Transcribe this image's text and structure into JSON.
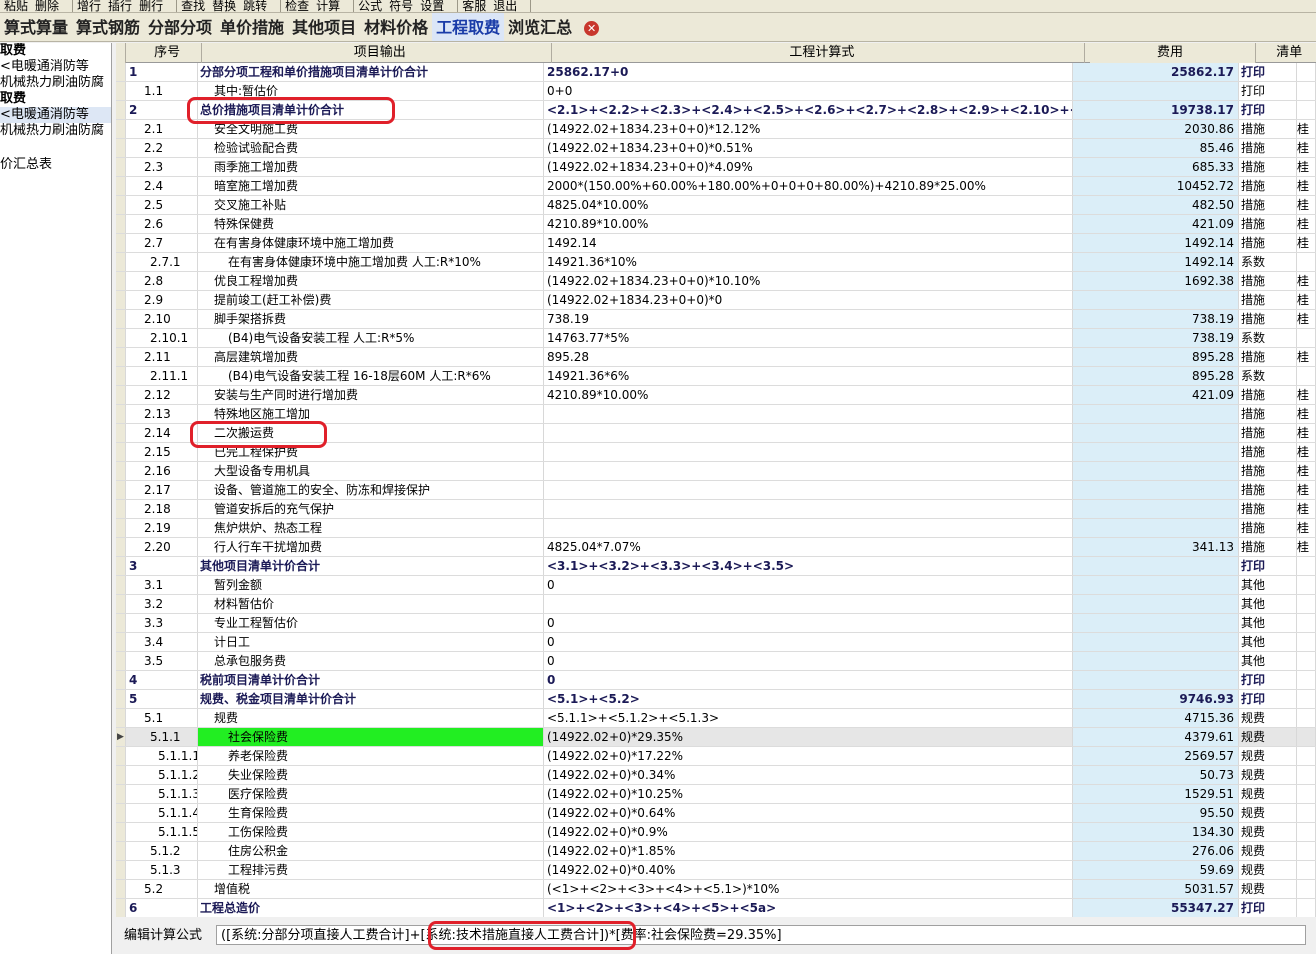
{
  "menu": {
    "groups": [
      {
        "items": [
          "粘贴",
          "删除"
        ]
      },
      {
        "items": [
          "增行",
          "插行",
          "删行"
        ]
      },
      {
        "items": [
          "查找",
          "替换",
          "跳转"
        ]
      },
      {
        "items": [
          "检查",
          "计算"
        ]
      },
      {
        "items": [
          "公式",
          "符号",
          "设置"
        ]
      },
      {
        "items": [
          "客服",
          "退出"
        ]
      }
    ]
  },
  "tabs": [
    "算式算量",
    "算式钢筋",
    "分部分项",
    "单价措施",
    "其他项目",
    "材料价格",
    "工程取费",
    "浏览汇总"
  ],
  "active_tab": "工程取费",
  "tree": [
    "取费",
    "<电暖通消防等",
    "机械热力刷油防腐",
    "取费",
    "<电暖通消防等",
    "机械热力刷油防腐",
    "价汇总表"
  ],
  "columns": [
    "序号",
    "项目输出",
    "工程计算式",
    "费用",
    "清单"
  ],
  "rows": [
    {
      "seq": "1",
      "name": "分部分项工程和单价措施项目清单计价合计",
      "formula": "25862.17+0",
      "fee": "25862.17",
      "type": "打印",
      "extra": "",
      "bold": true
    },
    {
      "seq": "1.1",
      "name": "其中:暂估价",
      "formula": "0+0",
      "fee": "",
      "type": "打印",
      "extra": ""
    },
    {
      "seq": "2",
      "name": "总价措施项目清单计价合计",
      "formula": "<2.1>+<2.2>+<2.3>+<2.4>+<2.5>+<2.6>+<2.7>+<2.8>+<2.9>+<2.10>+<2.11",
      "fee": "19738.17",
      "type": "打印",
      "extra": "",
      "bold": true
    },
    {
      "seq": "2.1",
      "name": "安全文明施工费",
      "formula": "(14922.02+1834.23+0+0)*12.12%",
      "fee": "2030.86",
      "type": "措施",
      "extra": "桂"
    },
    {
      "seq": "2.2",
      "name": "检验试验配合费",
      "formula": "(14922.02+1834.23+0+0)*0.51%",
      "fee": "85.46",
      "type": "措施",
      "extra": "桂"
    },
    {
      "seq": "2.3",
      "name": "雨季施工增加费",
      "formula": "(14922.02+1834.23+0+0)*4.09%",
      "fee": "685.33",
      "type": "措施",
      "extra": "桂"
    },
    {
      "seq": "2.4",
      "name": "暗室施工增加费",
      "formula": "2000*(150.00%+60.00%+180.00%+0+0+0+80.00%)+4210.89*25.00%",
      "fee": "10452.72",
      "type": "措施",
      "extra": "桂"
    },
    {
      "seq": "2.5",
      "name": "交叉施工补贴",
      "formula": "4825.04*10.00%",
      "fee": "482.50",
      "type": "措施",
      "extra": "桂"
    },
    {
      "seq": "2.6",
      "name": "特殊保健费",
      "formula": "4210.89*10.00%",
      "fee": "421.09",
      "type": "措施",
      "extra": "桂"
    },
    {
      "seq": "2.7",
      "name": "在有害身体健康环境中施工增加费",
      "formula": "1492.14",
      "fee": "1492.14",
      "type": "措施",
      "extra": "桂"
    },
    {
      "seq": "2.7.1",
      "name": "在有害身体健康环境中施工增加费 人工:R*10%",
      "formula": "14921.36*10%",
      "fee": "1492.14",
      "type": "系数",
      "extra": "",
      "indent": 2
    },
    {
      "seq": "2.8",
      "name": "优良工程增加费",
      "formula": "(14922.02+1834.23+0+0)*10.10%",
      "fee": "1692.38",
      "type": "措施",
      "extra": "桂"
    },
    {
      "seq": "2.9",
      "name": "提前竣工(赶工补偿)费",
      "formula": "(14922.02+1834.23+0+0)*0",
      "fee": "",
      "type": "措施",
      "extra": "桂"
    },
    {
      "seq": "2.10",
      "name": "脚手架搭拆费",
      "formula": "738.19",
      "fee": "738.19",
      "type": "措施",
      "extra": "桂"
    },
    {
      "seq": "2.10.1",
      "name": "(B4)电气设备安装工程 人工:R*5%",
      "formula": "14763.77*5%",
      "fee": "738.19",
      "type": "系数",
      "extra": "",
      "indent": 2
    },
    {
      "seq": "2.11",
      "name": "高层建筑增加费",
      "formula": "895.28",
      "fee": "895.28",
      "type": "措施",
      "extra": "桂"
    },
    {
      "seq": "2.11.1",
      "name": "(B4)电气设备安装工程 16-18层60M 人工:R*6%",
      "formula": "14921.36*6%",
      "fee": "895.28",
      "type": "系数",
      "extra": "",
      "indent": 2
    },
    {
      "seq": "2.12",
      "name": "安装与生产同时进行增加费",
      "formula": "4210.89*10.00%",
      "fee": "421.09",
      "type": "措施",
      "extra": "桂"
    },
    {
      "seq": "2.13",
      "name": "特殊地区施工增加",
      "formula": "",
      "fee": "",
      "type": "措施",
      "extra": "桂"
    },
    {
      "seq": "2.14",
      "name": "二次搬运费",
      "formula": "",
      "fee": "",
      "type": "措施",
      "extra": "桂"
    },
    {
      "seq": "2.15",
      "name": "已完工程保护费",
      "formula": "",
      "fee": "",
      "type": "措施",
      "extra": "桂"
    },
    {
      "seq": "2.16",
      "name": "大型设备专用机具",
      "formula": "",
      "fee": "",
      "type": "措施",
      "extra": "桂"
    },
    {
      "seq": "2.17",
      "name": "设备、管道施工的安全、防冻和焊接保护",
      "formula": "",
      "fee": "",
      "type": "措施",
      "extra": "桂"
    },
    {
      "seq": "2.18",
      "name": "管道安拆后的充气保护",
      "formula": "",
      "fee": "",
      "type": "措施",
      "extra": "桂"
    },
    {
      "seq": "2.19",
      "name": "焦炉烘炉、热态工程",
      "formula": "",
      "fee": "",
      "type": "措施",
      "extra": "桂"
    },
    {
      "seq": "2.20",
      "name": "行人行车干扰增加费",
      "formula": "4825.04*7.07%",
      "fee": "341.13",
      "type": "措施",
      "extra": "桂"
    },
    {
      "seq": "3",
      "name": "其他项目清单计价合计",
      "formula": "<3.1>+<3.2>+<3.3>+<3.4>+<3.5>",
      "fee": "",
      "type": "打印",
      "extra": "",
      "bold": true
    },
    {
      "seq": "3.1",
      "name": "暂列金额",
      "formula": "0",
      "fee": "",
      "type": "其他",
      "extra": ""
    },
    {
      "seq": "3.2",
      "name": "材料暂估价",
      "formula": "",
      "fee": "",
      "type": "其他",
      "extra": ""
    },
    {
      "seq": "3.3",
      "name": "专业工程暂估价",
      "formula": "0",
      "fee": "",
      "type": "其他",
      "extra": ""
    },
    {
      "seq": "3.4",
      "name": "计日工",
      "formula": "0",
      "fee": "",
      "type": "其他",
      "extra": ""
    },
    {
      "seq": "3.5",
      "name": "总承包服务费",
      "formula": "0",
      "fee": "",
      "type": "其他",
      "extra": ""
    },
    {
      "seq": "4",
      "name": "税前项目清单计价合计",
      "formula": "0",
      "fee": "",
      "type": "打印",
      "extra": "",
      "bold": true
    },
    {
      "seq": "5",
      "name": "规费、税金项目清单计价合计",
      "formula": "<5.1>+<5.2>",
      "fee": "9746.93",
      "type": "打印",
      "extra": "",
      "bold": true
    },
    {
      "seq": "5.1",
      "name": "规费",
      "formula": "<5.1.1>+<5.1.2>+<5.1.3>",
      "fee": "4715.36",
      "type": "规费",
      "extra": ""
    },
    {
      "seq": "5.1.1",
      "name": "社会保险费",
      "formula": "(14922.02+0)*29.35%",
      "fee": "4379.61",
      "type": "规费",
      "extra": "",
      "indent": 2,
      "current": true
    },
    {
      "seq": "5.1.1.1",
      "name": "养老保险费",
      "formula": "(14922.02+0)*17.22%",
      "fee": "2569.57",
      "type": "规费",
      "extra": "",
      "indent": 2
    },
    {
      "seq": "5.1.1.2",
      "name": "失业保险费",
      "formula": "(14922.02+0)*0.34%",
      "fee": "50.73",
      "type": "规费",
      "extra": "",
      "indent": 2
    },
    {
      "seq": "5.1.1.3",
      "name": "医疗保险费",
      "formula": "(14922.02+0)*10.25%",
      "fee": "1529.51",
      "type": "规费",
      "extra": "",
      "indent": 2
    },
    {
      "seq": "5.1.1.4",
      "name": "生育保险费",
      "formula": "(14922.02+0)*0.64%",
      "fee": "95.50",
      "type": "规费",
      "extra": "",
      "indent": 2
    },
    {
      "seq": "5.1.1.5",
      "name": "工伤保险费",
      "formula": "(14922.02+0)*0.9%",
      "fee": "134.30",
      "type": "规费",
      "extra": "",
      "indent": 2
    },
    {
      "seq": "5.1.2",
      "name": "住房公积金",
      "formula": "(14922.02+0)*1.85%",
      "fee": "276.06",
      "type": "规费",
      "extra": "",
      "indent": 2
    },
    {
      "seq": "5.1.3",
      "name": "工程排污费",
      "formula": "(14922.02+0)*0.40%",
      "fee": "59.69",
      "type": "规费",
      "extra": "",
      "indent": 2
    },
    {
      "seq": "5.2",
      "name": "增值税",
      "formula": "(<1>+<2>+<3>+<4>+<5.1>)*10%",
      "fee": "5031.57",
      "type": "规费",
      "extra": ""
    },
    {
      "seq": "6",
      "name": "工程总造价",
      "formula": "<1>+<2>+<3>+<4>+<5>+<5a>",
      "fee": "55347.27",
      "type": "打印",
      "extra": "",
      "bold": true
    }
  ],
  "status": {
    "label": "编辑计算公式",
    "formula": "([系统:分部分项直接人工费合计]+[系统:技术措施直接人工费合计])*[费率:社会保险费=29.35%]"
  },
  "colors": {
    "highlight_red": "#e0202a",
    "fee_column": "#dbeef8",
    "current_cell": "#22ee22"
  }
}
